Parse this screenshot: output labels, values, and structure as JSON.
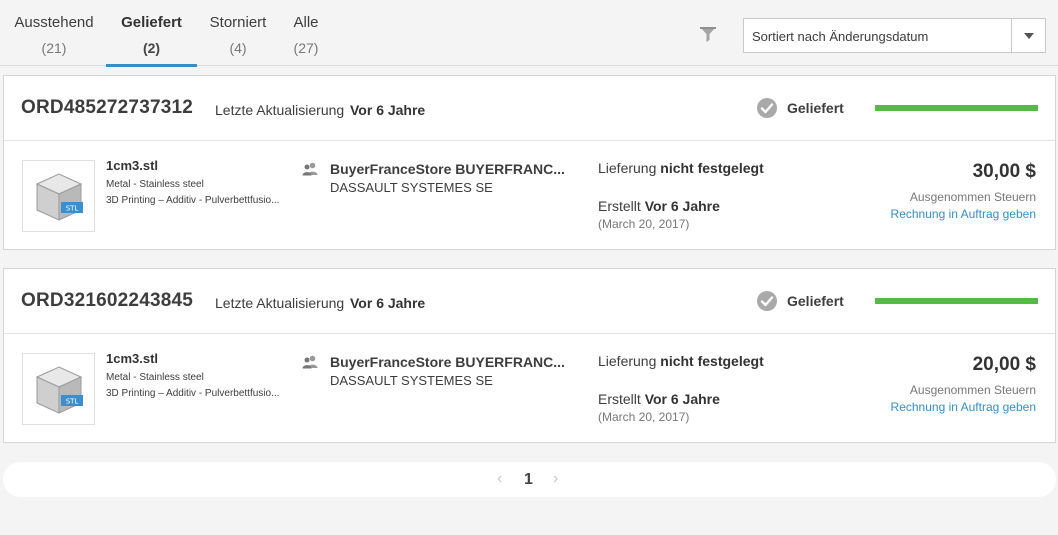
{
  "tabs": [
    {
      "label": "Ausstehend",
      "count": "(21)"
    },
    {
      "label": "Geliefert",
      "count": "(2)"
    },
    {
      "label": "Storniert",
      "count": "(4)"
    },
    {
      "label": "Alle",
      "count": "(27)"
    }
  ],
  "active_tab": "Geliefert",
  "filter_icon": "filter-icon",
  "sort": {
    "selected": "Sortiert nach Änderungsdatum"
  },
  "orders": [
    {
      "id": "ORD485272737312",
      "update_label": "Letzte Aktualisierung",
      "update_value": "Vor 6 Jahre",
      "status": "Geliefert",
      "progress_fraction": 1.0,
      "file_name": "1cm3.stl",
      "material": "Metal - Stainless steel",
      "process": "3D Printing – Additiv - Pulverbettfusio...",
      "buyer_name": "BuyerFranceStore BUYERFRANC...",
      "buyer_company": "DASSAULT SYSTEMES SE",
      "delivery_label": "Lieferung",
      "delivery_value": "nicht festgelegt",
      "created_label": "Erstellt",
      "created_value": "Vor 6 Jahre",
      "created_date": "(March 20, 2017)",
      "price": "30,00 $",
      "tax_note": "Ausgenommen Steuern",
      "invoice_link": "Rechnung in Auftrag geben"
    },
    {
      "id": "ORD321602243845",
      "update_label": "Letzte Aktualisierung",
      "update_value": "Vor 6 Jahre",
      "status": "Geliefert",
      "progress_fraction": 1.0,
      "file_name": "1cm3.stl",
      "material": "Metal - Stainless steel",
      "process": "3D Printing – Additiv - Pulverbettfusio...",
      "buyer_name": "BuyerFranceStore BUYERFRANC...",
      "buyer_company": "DASSAULT SYSTEMES SE",
      "delivery_label": "Lieferung",
      "delivery_value": "nicht festgelegt",
      "created_label": "Erstellt",
      "created_value": "Vor 6 Jahre",
      "created_date": "(March 20, 2017)",
      "price": "20,00 $",
      "tax_note": "Ausgenommen Steuern",
      "invoice_link": "Rechnung in Auftrag geben"
    }
  ],
  "pagination": {
    "prev": "‹",
    "current": "1",
    "next": "›"
  },
  "colors": {
    "accent": "#368ec4",
    "progress": "#57b947"
  }
}
